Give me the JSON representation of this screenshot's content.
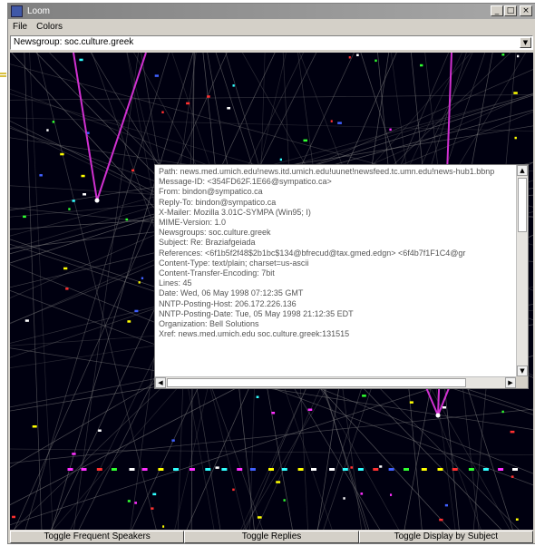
{
  "window": {
    "title": "Loom",
    "minimize_glyph": "_",
    "maximize_glyph": "□",
    "close_glyph": "×"
  },
  "menu": [
    "File",
    "Colors"
  ],
  "newsgroup_selector": {
    "value": "Newsgroup: soc.culture.greek",
    "arrow_glyph": "▼"
  },
  "message_header": {
    "lines": [
      "Path: news.med.umich.edu!news.itd.umich.edu!uunet!newsfeed.tc.umn.edu!news-hub1.bbnp",
      "Message-ID: <354FD62F.1E66@sympatico.ca>",
      "From: bindon@sympatico.ca",
      "Reply-To: bindon@sympatico.ca",
      "X-Mailer: Mozilla 3.01C-SYMPA (Win95; I)",
      "MIME-Version: 1.0",
      "Newsgroups: soc.culture.greek",
      "Subject: Re: Braziafgeiada",
      "References: <6f1b5f2f48$2b1bc$134@bfrecud@tax.gmed.edgn> <6f4b7f1F1C4@gr",
      "Content-Type: text/plain; charset=us-ascii",
      "Content-Transfer-Encoding: 7bit",
      "Lines: 45",
      "Date: Wed, 06 May 1998 07:12:35 GMT",
      "NNTP-Posting-Host: 206.172.226.136",
      "NNTP-Posting-Date: Tue, 05 May 1998 21:12:35 EDT",
      "Organization: Bell Solutions",
      "Xref: news.med.umich.edu soc.culture.greek:131515"
    ]
  },
  "scroll_glyphs": {
    "up": "▲",
    "down": "▼",
    "left": "◀",
    "right": "▶"
  },
  "toggles": {
    "frequent_speakers": "Toggle Frequent Speakers",
    "replies": "Toggle Replies",
    "display_by_subject": "Toggle Display by Subject"
  },
  "colors": {
    "canvas_bg": "#000010",
    "thread_line": "#8a8a8a",
    "reply_line": "#d030d0",
    "reply_node": "#ffffff"
  },
  "dot_colors": [
    "#ffff00",
    "#ff3030",
    "#30ff30",
    "#4060ff",
    "#ffffff",
    "#ff30ff",
    "#30ffff"
  ]
}
